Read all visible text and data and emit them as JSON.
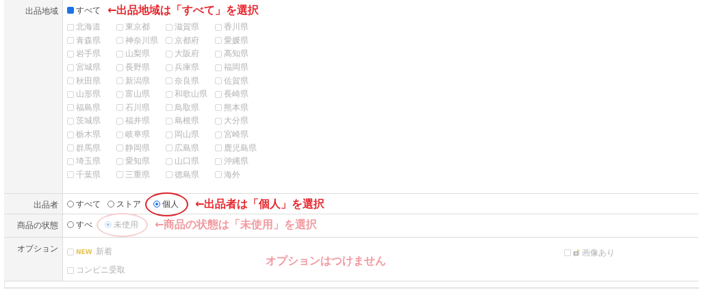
{
  "rows": [
    {
      "label": "出品地域",
      "kind": "region",
      "all": {
        "label": "すべて",
        "checked": true
      },
      "prefectures": [
        {
          "label": "北海道",
          "checked": false,
          "disabled": true
        },
        {
          "label": "東京都",
          "checked": false,
          "disabled": true
        },
        {
          "label": "滋賀県",
          "checked": false,
          "disabled": true
        },
        {
          "label": "香川県",
          "checked": false,
          "disabled": true
        },
        {
          "label": "青森県",
          "checked": false,
          "disabled": true
        },
        {
          "label": "神奈川県",
          "checked": false,
          "disabled": true
        },
        {
          "label": "京都府",
          "checked": false,
          "disabled": true
        },
        {
          "label": "愛媛県",
          "checked": false,
          "disabled": true
        },
        {
          "label": "岩手県",
          "checked": false,
          "disabled": true
        },
        {
          "label": "山梨県",
          "checked": false,
          "disabled": true
        },
        {
          "label": "大阪府",
          "checked": false,
          "disabled": true
        },
        {
          "label": "高知県",
          "checked": false,
          "disabled": true
        },
        {
          "label": "宮城県",
          "checked": false,
          "disabled": true
        },
        {
          "label": "長野県",
          "checked": false,
          "disabled": true
        },
        {
          "label": "兵庫県",
          "checked": false,
          "disabled": true
        },
        {
          "label": "福岡県",
          "checked": false,
          "disabled": true
        },
        {
          "label": "秋田県",
          "checked": false,
          "disabled": true
        },
        {
          "label": "新潟県",
          "checked": false,
          "disabled": true
        },
        {
          "label": "奈良県",
          "checked": false,
          "disabled": true
        },
        {
          "label": "佐賀県",
          "checked": false,
          "disabled": true
        },
        {
          "label": "山形県",
          "checked": false,
          "disabled": true
        },
        {
          "label": "富山県",
          "checked": false,
          "disabled": true
        },
        {
          "label": "和歌山県",
          "checked": false,
          "disabled": true
        },
        {
          "label": "長崎県",
          "checked": false,
          "disabled": true
        },
        {
          "label": "福島県",
          "checked": false,
          "disabled": true
        },
        {
          "label": "石川県",
          "checked": false,
          "disabled": true
        },
        {
          "label": "鳥取県",
          "checked": false,
          "disabled": true
        },
        {
          "label": "熊本県",
          "checked": false,
          "disabled": true
        },
        {
          "label": "茨城県",
          "checked": false,
          "disabled": true
        },
        {
          "label": "福井県",
          "checked": false,
          "disabled": true
        },
        {
          "label": "島根県",
          "checked": false,
          "disabled": true
        },
        {
          "label": "大分県",
          "checked": false,
          "disabled": true
        },
        {
          "label": "栃木県",
          "checked": false,
          "disabled": true
        },
        {
          "label": "岐阜県",
          "checked": false,
          "disabled": true
        },
        {
          "label": "岡山県",
          "checked": false,
          "disabled": true
        },
        {
          "label": "宮崎県",
          "checked": false,
          "disabled": true
        },
        {
          "label": "群馬県",
          "checked": false,
          "disabled": true
        },
        {
          "label": "静岡県",
          "checked": false,
          "disabled": true
        },
        {
          "label": "広島県",
          "checked": false,
          "disabled": true
        },
        {
          "label": "鹿児島県",
          "checked": false,
          "disabled": true
        },
        {
          "label": "埼玉県",
          "checked": false,
          "disabled": true
        },
        {
          "label": "愛知県",
          "checked": false,
          "disabled": true
        },
        {
          "label": "山口県",
          "checked": false,
          "disabled": true
        },
        {
          "label": "沖縄県",
          "checked": false,
          "disabled": true
        },
        {
          "label": "千葉県",
          "checked": false,
          "disabled": true
        },
        {
          "label": "三重県",
          "checked": false,
          "disabled": true
        },
        {
          "label": "徳島県",
          "checked": false,
          "disabled": true
        },
        {
          "label": "海外",
          "checked": false,
          "disabled": true
        }
      ],
      "annotation": {
        "text": "←出品地域は「すべて」を選択",
        "faded": false
      }
    },
    {
      "label": "出品者",
      "kind": "radio",
      "options": [
        {
          "label": "すべて",
          "selected": false,
          "disabled": false,
          "circled": false
        },
        {
          "label": "ストア",
          "selected": false,
          "disabled": false,
          "circled": false
        },
        {
          "label": "個人",
          "selected": true,
          "disabled": false,
          "circled": true
        }
      ],
      "annotation": {
        "text": "←出品者は「個人」を選択",
        "faded": false
      }
    },
    {
      "label": "商品の状態",
      "kind": "radio",
      "options": [
        {
          "label": "すべ",
          "selected": false,
          "disabled": false,
          "circled": false
        },
        {
          "label": "未使用",
          "selected": true,
          "disabled": true,
          "circled": true
        }
      ],
      "annotation": {
        "text": "←商品の状態は「未使用」を選択",
        "faded": true
      }
    },
    {
      "label": "オプション",
      "kind": "options",
      "left": [
        {
          "label": "新着",
          "badge": "NEW",
          "checked": false,
          "disabled": true
        },
        {
          "label": "コンビニ受取",
          "checked": false,
          "disabled": true
        }
      ],
      "right": [
        {
          "label": "画像あり",
          "kind": "image",
          "checked": false,
          "disabled": true
        }
      ],
      "annotation": {
        "text": "オプションはつけません",
        "faded": true
      }
    }
  ]
}
